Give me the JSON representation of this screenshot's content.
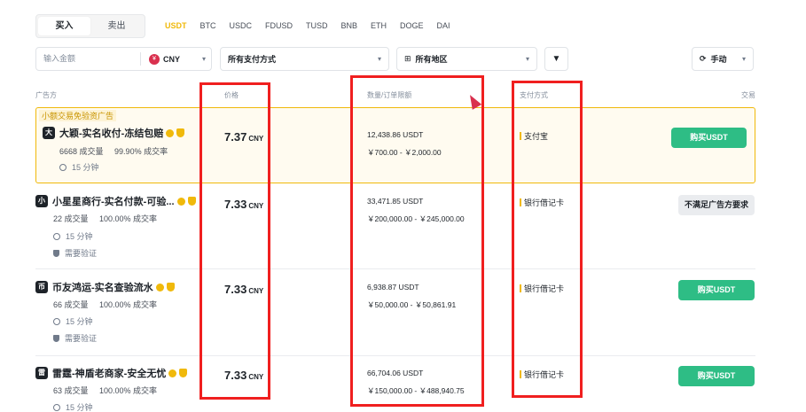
{
  "trade_tabs": {
    "buy": "买入",
    "sell": "卖出"
  },
  "coins": [
    "USDT",
    "BTC",
    "USDC",
    "FDUSD",
    "TUSD",
    "BNB",
    "ETH",
    "DOGE",
    "DAI"
  ],
  "filters": {
    "amount_placeholder": "输入金额",
    "currency": "CNY",
    "currency_icon": "¥",
    "payment": "所有支付方式",
    "region": "所有地区",
    "refresh": "手动"
  },
  "columns": {
    "advertiser": "广告方",
    "price": "价格",
    "quantity": "数量/订单限额",
    "payment": "支付方式",
    "trade": "交易"
  },
  "promo_label": "小额交易免验资广告",
  "rows": [
    {
      "avatar": "大",
      "name": "大颖-实名收付-冻结包赔",
      "orders": "6668 成交量",
      "completion": "99.90% 成交率",
      "time": "15 分钟",
      "verify": "",
      "price": "7.37",
      "unit": "CNY",
      "quantity": "12,438.86 USDT",
      "limit": "￥700.00 - ￥2,000.00",
      "payment": "支付宝",
      "action": "购买USDT"
    },
    {
      "avatar": "小",
      "name": "小星星商行-实名付款-可验...",
      "orders": "22 成交量",
      "completion": "100.00% 成交率",
      "time": "15 分钟",
      "verify": "需要验证",
      "price": "7.33",
      "unit": "CNY",
      "quantity": "33,471.85 USDT",
      "limit": "￥200,000.00 - ￥245,000.00",
      "payment": "银行借记卡",
      "action": "不满足广告方要求"
    },
    {
      "avatar": "币",
      "name": "币友鸿运-实名查验流水",
      "orders": "66 成交量",
      "completion": "100.00% 成交率",
      "time": "15 分钟",
      "verify": "需要验证",
      "price": "7.33",
      "unit": "CNY",
      "quantity": "6,938.87 USDT",
      "limit": "￥50,000.00 - ￥50,861.91",
      "payment": "银行借记卡",
      "action": "购买USDT"
    },
    {
      "avatar": "雷",
      "name": "雷霆-神盾老商家-安全无忧",
      "orders": "63 成交量",
      "completion": "100.00% 成交率",
      "time": "15 分钟",
      "verify": "",
      "price": "7.33",
      "unit": "CNY",
      "quantity": "66,704.06 USDT",
      "limit": "￥150,000.00 - ￥488,940.75",
      "payment": "银行借记卡",
      "action": "购买USDT"
    }
  ]
}
